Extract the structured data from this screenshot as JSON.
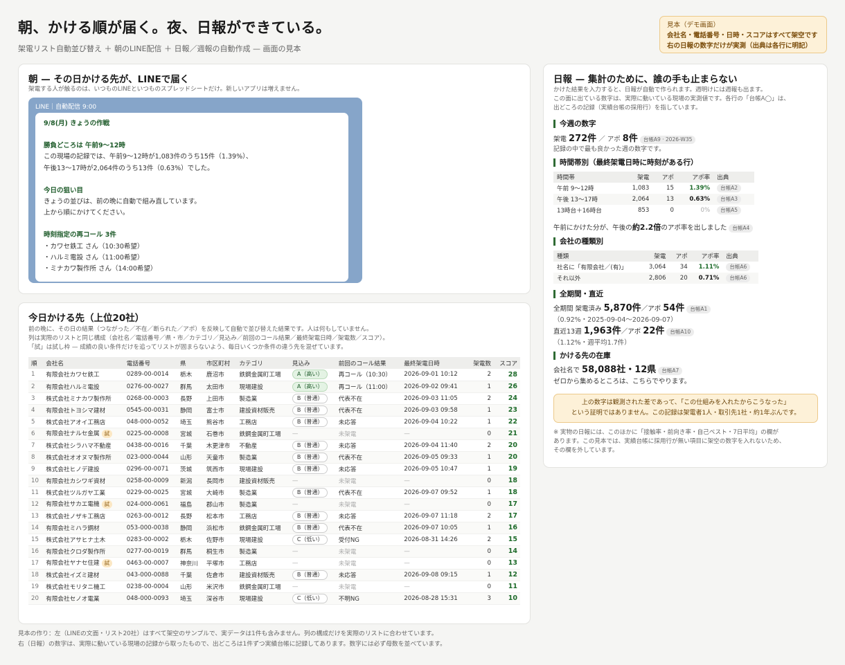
{
  "header": {
    "title": "朝、かける順が届く。夜、日報ができている。",
    "subtitle": "架電リスト自動並び替え ＋ 朝のLINE配信 ＋ 日報／週報の自動作成 — 画面の見本"
  },
  "demo_notice": {
    "line1": "見本（デモ画面）",
    "line2": "会社名・電話番号・日時・スコアはすべて架空です",
    "line3": "右の日報の数字だけが実測（出典は各行に明記）"
  },
  "morning": {
    "title": "朝 — その日かける先が、LINEで届く",
    "desc": "架電する人が触るのは、いつものLINEといつものスプレッドシートだけ。新しいアプリは増えません。",
    "line_header": "LINE｜自動配信 9:00",
    "msg_title": "9/8(月) きょうの作戦",
    "peak_label": "勝負どころは 午前9〜12時",
    "peak_line1": "この現場の記録では、午前9〜12時が1,083件のうち15件（1.39%）、",
    "peak_line2": "午後13〜17時が2,064件のうち13件（0.63%）でした。",
    "aim_label": "今日の狙い目",
    "aim_line1": "きょうの並びは、前の晩に自動で組み直しています。",
    "aim_line2": "上から順にかけてください。",
    "recall_label": "時刻指定の再コール 3件",
    "recall_1": "・カワセ鉄工 さん（10:30希望）",
    "recall_2": "・ハルミ電設 さん（11:00希望）",
    "recall_3": "・ミナカワ製作所 さん（14:00希望）"
  },
  "list": {
    "title": "今日かける先（上位20社）",
    "desc1": "前の晩に、その日の結果（つながった／不在／断られた／アポ）を反映して自動で並び替えた結果です。人は何もしていません。",
    "desc2": "列は実際のリストと同じ構成（会社名／電話番号／県・市／カテゴリ／見込み／前回のコール結果／最終架電日時／架電数／スコア）。",
    "desc3": "「試」は試し枠 — 成績の良い条件だけを追ってリストが固まらないよう、毎日いくつか条件の違う先を混ぜています。",
    "headers": [
      "順",
      "会社名",
      "電話番号",
      "県",
      "市区町村",
      "カテゴリ",
      "見込み",
      "前回のコール結果",
      "最終架電日時",
      "架電数",
      "スコア"
    ],
    "rows": [
      {
        "n": "1",
        "company": "有限会社カワセ鉄工",
        "trial": "",
        "tel": "0289-00-0014",
        "pref": "栃木",
        "city": "鹿沼市",
        "cat": "鉄鋼金属町工場",
        "prospect": "A（高い）",
        "ptype": "a",
        "result": "再コール（10:30）",
        "date": "2026-09-01 10:12",
        "calls": "2",
        "score": "28"
      },
      {
        "n": "2",
        "company": "有限会社ハルミ電設",
        "trial": "",
        "tel": "0276-00-0027",
        "pref": "群馬",
        "city": "太田市",
        "cat": "現場建設",
        "prospect": "A（高い）",
        "ptype": "a",
        "result": "再コール（11:00）",
        "date": "2026-09-02 09:41",
        "calls": "1",
        "score": "26"
      },
      {
        "n": "3",
        "company": "株式会社ミナカワ製作所",
        "trial": "",
        "tel": "0268-00-0003",
        "pref": "長野",
        "city": "上田市",
        "cat": "製造業",
        "prospect": "B（普通）",
        "ptype": "b",
        "result": "代表不在",
        "date": "2026-09-03 11:05",
        "calls": "2",
        "score": "24"
      },
      {
        "n": "4",
        "company": "有限会社トヨシマ建材",
        "trial": "",
        "tel": "0545-00-0031",
        "pref": "静岡",
        "city": "富士市",
        "cat": "建設資材販売",
        "prospect": "B（普通）",
        "ptype": "b",
        "result": "代表不在",
        "date": "2026-09-03 09:58",
        "calls": "1",
        "score": "23"
      },
      {
        "n": "5",
        "company": "株式会社アオイ工務店",
        "trial": "",
        "tel": "048-000-0052",
        "pref": "埼玉",
        "city": "熊谷市",
        "cat": "工務店",
        "prospect": "B（普通）",
        "ptype": "b",
        "result": "未応答",
        "date": "2026-09-04 10:22",
        "calls": "1",
        "score": "22"
      },
      {
        "n": "6",
        "company": "有限会社ナルセ金属",
        "trial": "試",
        "tel": "0225-00-0008",
        "pref": "宮城",
        "city": "石巻市",
        "cat": "鉄鋼金属町工場",
        "prospect": "—",
        "ptype": "none",
        "result": "未架電",
        "date": "—",
        "calls": "0",
        "score": "21"
      },
      {
        "n": "7",
        "company": "株式会社シラハマ不動産",
        "trial": "",
        "tel": "0438-00-0016",
        "pref": "千葉",
        "city": "木更津市",
        "cat": "不動産",
        "prospect": "B（普通）",
        "ptype": "b",
        "result": "未応答",
        "date": "2026-09-04 11:40",
        "calls": "2",
        "score": "20"
      },
      {
        "n": "8",
        "company": "株式会社オオヌマ製作所",
        "trial": "",
        "tel": "023-000-0044",
        "pref": "山形",
        "city": "天童市",
        "cat": "製造業",
        "prospect": "B（普通）",
        "ptype": "b",
        "result": "代表不在",
        "date": "2026-09-05 09:33",
        "calls": "1",
        "score": "20"
      },
      {
        "n": "9",
        "company": "株式会社ヒノデ建設",
        "trial": "",
        "tel": "0296-00-0071",
        "pref": "茨城",
        "city": "筑西市",
        "cat": "現場建設",
        "prospect": "B（普通）",
        "ptype": "b",
        "result": "未応答",
        "date": "2026-09-05 10:47",
        "calls": "1",
        "score": "19"
      },
      {
        "n": "10",
        "company": "有限会社カシワギ資材",
        "trial": "",
        "tel": "0258-00-0009",
        "pref": "新潟",
        "city": "長岡市",
        "cat": "建設資材販売",
        "prospect": "—",
        "ptype": "none",
        "result": "未架電",
        "date": "—",
        "calls": "0",
        "score": "18"
      },
      {
        "n": "11",
        "company": "株式会社ツルガヤ工業",
        "trial": "",
        "tel": "0229-00-0025",
        "pref": "宮城",
        "city": "大崎市",
        "cat": "製造業",
        "prospect": "B（普通）",
        "ptype": "b",
        "result": "代表不在",
        "date": "2026-09-07 09:52",
        "calls": "1",
        "score": "18"
      },
      {
        "n": "12",
        "company": "有限会社サカエ電機",
        "trial": "試",
        "tel": "024-000-0061",
        "pref": "福島",
        "city": "郡山市",
        "cat": "製造業",
        "prospect": "—",
        "ptype": "none",
        "result": "未架電",
        "date": "—",
        "calls": "0",
        "score": "17"
      },
      {
        "n": "13",
        "company": "株式会社ノザキ工務店",
        "trial": "",
        "tel": "0263-00-0012",
        "pref": "長野",
        "city": "松本市",
        "cat": "工務店",
        "prospect": "B（普通）",
        "ptype": "b",
        "result": "未応答",
        "date": "2026-09-07 11:18",
        "calls": "2",
        "score": "17"
      },
      {
        "n": "14",
        "company": "有限会社ミハラ鋼材",
        "trial": "",
        "tel": "053-000-0038",
        "pref": "静岡",
        "city": "浜松市",
        "cat": "鉄鋼金属町工場",
        "prospect": "B（普通）",
        "ptype": "b",
        "result": "代表不在",
        "date": "2026-09-07 10:05",
        "calls": "1",
        "score": "16"
      },
      {
        "n": "15",
        "company": "株式会社アサヒナ土木",
        "trial": "",
        "tel": "0283-00-0002",
        "pref": "栃木",
        "city": "佐野市",
        "cat": "現場建設",
        "prospect": "C（低い）",
        "ptype": "c",
        "result": "受付NG",
        "date": "2026-08-31 14:26",
        "calls": "2",
        "score": "15"
      },
      {
        "n": "16",
        "company": "有限会社クロダ製作所",
        "trial": "",
        "tel": "0277-00-0019",
        "pref": "群馬",
        "city": "桐生市",
        "cat": "製造業",
        "prospect": "—",
        "ptype": "none",
        "result": "未架電",
        "date": "—",
        "calls": "0",
        "score": "14"
      },
      {
        "n": "17",
        "company": "有限会社ヤナセ住建",
        "trial": "試",
        "tel": "0463-00-0007",
        "pref": "神奈川",
        "city": "平塚市",
        "cat": "工務店",
        "prospect": "—",
        "ptype": "none",
        "result": "未架電",
        "date": "—",
        "calls": "0",
        "score": "13"
      },
      {
        "n": "18",
        "company": "株式会社イズミ建材",
        "trial": "",
        "tel": "043-000-0088",
        "pref": "千葉",
        "city": "佐倉市",
        "cat": "建設資材販売",
        "prospect": "B（普通）",
        "ptype": "b",
        "result": "未応答",
        "date": "2026-09-08 09:15",
        "calls": "1",
        "score": "12"
      },
      {
        "n": "19",
        "company": "株式会社モリタニ機工",
        "trial": "",
        "tel": "0238-00-0004",
        "pref": "山形",
        "city": "米沢市",
        "cat": "鉄鋼金属町工場",
        "prospect": "—",
        "ptype": "none",
        "result": "未架電",
        "date": "—",
        "calls": "0",
        "score": "11"
      },
      {
        "n": "20",
        "company": "有限会社セノオ電業",
        "trial": "",
        "tel": "048-000-0093",
        "pref": "埼玉",
        "city": "深谷市",
        "cat": "現場建設",
        "prospect": "C（低い）",
        "ptype": "c",
        "result": "不明NG",
        "date": "2026-08-28 15:31",
        "calls": "3",
        "score": "10"
      }
    ]
  },
  "report": {
    "title": "日報 — 集計のために、誰の手も止まらない",
    "desc1": "かけた結果を入力すると、日報が自動で作られます。週明けには週報も出ます。",
    "desc2": "この面に出ている数字は、実際に動いている現場の実測値です。各行の「台帳A◯」は、",
    "desc3": "出どころの記録（実績台帳の採用行）を指しています。",
    "week_title": "今週の数字",
    "week_calls_label": "架電",
    "week_calls": "272件",
    "week_sep": "／ アポ",
    "week_appo": "8件",
    "week_tag": "台帳A9 · 2026-W35",
    "week_note": "記録の中で最も良かった週の数字です。",
    "time_title": "時間帯別（最終架電日時に時刻がある行）",
    "time_headers": [
      "時間帯",
      "架電",
      "アポ",
      "アポ率",
      "出典"
    ],
    "time_rows": [
      {
        "label": "午前 9〜12時",
        "calls": "1,083",
        "appo": "15",
        "rate": "1.39%",
        "src": "台帳A2",
        "mute": false,
        "strong": false
      },
      {
        "label": "午後 13〜17時",
        "calls": "2,064",
        "appo": "13",
        "rate": "0.63%",
        "src": "台帳A3",
        "mute": false,
        "strong": true
      },
      {
        "label": "13時台＋16時台",
        "calls": "853",
        "appo": "0",
        "rate": "0%",
        "src": "台帳A5",
        "mute": true,
        "strong": false
      }
    ],
    "time_note_pre": "午前にかけた分が、午後の",
    "time_note_big": "約2.2倍",
    "time_note_post": "のアポ率を出しました",
    "time_note_tag": "台帳A4",
    "type_title": "会社の種類別",
    "type_headers": [
      "種類",
      "架電",
      "アポ",
      "アポ率",
      "出典"
    ],
    "type_rows": [
      {
        "label": "社名に「有限会社／(有)」",
        "calls": "3,064",
        "appo": "34",
        "rate": "1.11%",
        "src": "台帳A6",
        "strong": false
      },
      {
        "label": "それ以外",
        "calls": "2,806",
        "appo": "20",
        "rate": "0.71%",
        "src": "台帳A6",
        "strong": true
      }
    ],
    "all_title": "全期間・直近",
    "all_label": "全期間 架電済み",
    "all_calls": "5,870件",
    "all_sep": "／アポ",
    "all_appo": "54件",
    "all_tag": "台帳A1",
    "all_sub": "（0.92%・2025-09-04〜2026-09-07）",
    "recent_label": "直近13週",
    "recent_calls": "1,963件",
    "recent_sep": "／アポ",
    "recent_appo": "22件",
    "recent_tag": "台帳A10",
    "recent_sub": "（1.12%・週平均1.7件）",
    "stock_title": "かける先の在庫",
    "stock_label": "会社名で",
    "stock_value": "58,088社・12県",
    "stock_tag": "台帳A7",
    "stock_note": "ゼロから集めるところは、こちらでやります。",
    "caution1": "上の数字は観測された差であって、「この仕組みを入れたからこうなった」",
    "caution2": "という証明ではありません。この記録は架電者1人・取引先1社・約1年ぶんです。",
    "footnote1": "※ 実物の日報には、このほかに「接触率・前向き率・自己ベスト・7日平均」の欄が",
    "footnote2": "あります。この見本では、実績台帳に採用行が無い項目に架空の数字を入れないため、",
    "footnote3": "その欄を外しています。"
  },
  "footer": {
    "line1": "見本の作り：左（LINEの文面・リスト20社）はすべて架空のサンプルで、実データは1件も含みません。列の構成だけを実際のリストに合わせています。",
    "line2": "右（日報）の数字は、実際に動いている現場の記録から取ったもので、出どころは1件ずつ実績台帳に記録してあります。数字には必ず母数を並べています。"
  }
}
